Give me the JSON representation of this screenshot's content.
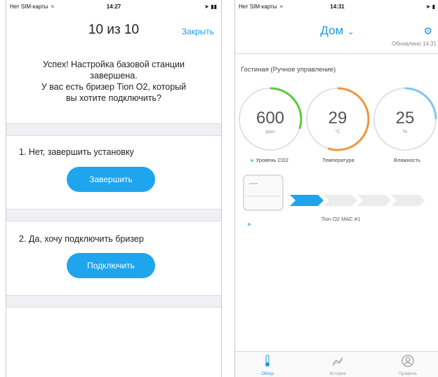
{
  "status_left": {
    "carrier": "Нет SIM-карты",
    "time": "14:27"
  },
  "status_right": {
    "carrier": "Нет SIM-карты",
    "time": "14:31"
  },
  "wizard": {
    "step": "10 из 10",
    "close_label": "Закрыть",
    "message_lines": [
      "Успех! Настройка базовой станции",
      "завершена.",
      "У вас есть бризер Tion O2, который",
      "вы хотите подключить?"
    ],
    "option1_label": "1. Нет, завершить установку",
    "option1_button": "Завершить",
    "option2_label": "2. Да, хочу подключить бризер",
    "option2_button": "Подключить"
  },
  "dashboard": {
    "title": "Дом",
    "updated": "Обновлено 14:31",
    "room": "Гостиная  (Ручное управление)",
    "gauges": [
      {
        "value": "600",
        "unit": "ppm",
        "label": "Уровень CO2",
        "color": "#5cc93a",
        "fraction": 0.3
      },
      {
        "value": "29",
        "unit": "°C",
        "label": "Температура",
        "color": "#f0953c",
        "fraction": 0.55
      },
      {
        "value": "25",
        "unit": "%",
        "label": "Влажность",
        "color": "#7cc6f2",
        "fraction": 0.25
      }
    ],
    "device_name": "Tion O2 MAC #1",
    "speed_level": 1,
    "speed_steps": 4
  },
  "tabs": [
    {
      "label": "Обзор",
      "icon": "thermometer-icon",
      "active": true
    },
    {
      "label": "История",
      "icon": "chart-icon",
      "active": false
    },
    {
      "label": "Профиль",
      "icon": "profile-icon",
      "active": false
    }
  ],
  "colors": {
    "accent": "#1a9be6",
    "button": "#1fa4ee",
    "separator": "#efeff4"
  }
}
